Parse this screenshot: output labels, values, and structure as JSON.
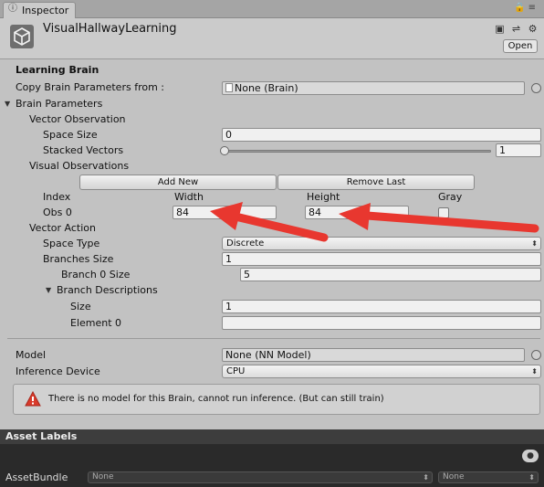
{
  "tab": {
    "title": "Inspector"
  },
  "header": {
    "object_name": "VisualHallwayLearning",
    "open_label": "Open"
  },
  "section_title": "Learning Brain",
  "copy_params": {
    "label": "Copy Brain Parameters from :",
    "value": "None (Brain)"
  },
  "brain_params": {
    "label": "Brain Parameters",
    "vector_observation": {
      "label": "Vector Observation",
      "space_size_label": "Space Size",
      "space_size_value": "0",
      "stacked_label": "Stacked Vectors",
      "stacked_value": "1"
    },
    "visual_observations": {
      "label": "Visual Observations",
      "add_new": "Add New",
      "remove_last": "Remove Last",
      "col_index": "Index",
      "col_width": "Width",
      "col_height": "Height",
      "col_gray": "Gray",
      "row": {
        "index": "Obs 0",
        "width": "84",
        "height": "84"
      }
    },
    "vector_action": {
      "label": "Vector Action",
      "space_type_label": "Space Type",
      "space_type_value": "Discrete",
      "branches_size_label": "Branches Size",
      "branches_size_value": "1",
      "branch0_label": "Branch 0 Size",
      "branch0_value": "5",
      "branch_desc_label": "Branch Descriptions",
      "size_label": "Size",
      "size_value": "1",
      "element0_label": "Element 0",
      "element0_value": ""
    }
  },
  "model": {
    "label": "Model",
    "value": "None (NN Model)"
  },
  "inference": {
    "label": "Inference Device",
    "value": "CPU"
  },
  "help": {
    "message": "There is no model for this Brain, cannot run inference. (But can still train)"
  },
  "asset": {
    "header": "Asset Labels",
    "bundle_label": "AssetBundle",
    "bundle_value": "None",
    "variant_value": "None"
  },
  "colors": {
    "arrow": "#e8372f",
    "warning": "#d93a2b"
  }
}
